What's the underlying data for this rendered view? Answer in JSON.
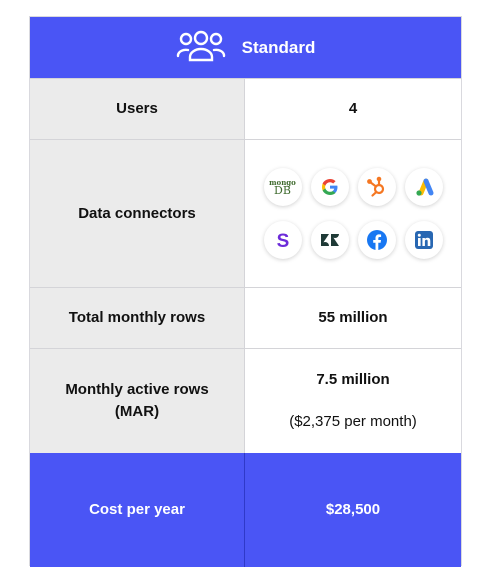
{
  "plan": {
    "title": "Standard",
    "icon": "users-group-icon",
    "accent": "#4a55f5"
  },
  "rows": [
    {
      "label": "Users",
      "value": "4"
    },
    {
      "label": "Data connectors"
    },
    {
      "label": "Total monthly rows",
      "value": "55 million"
    },
    {
      "label": "Monthly active rows (MAR)",
      "value": "7.5 million",
      "sub": "($2,375 per month)"
    },
    {
      "label": "Cost per year",
      "value": "$28,500"
    }
  ],
  "connectors": [
    {
      "icon": "mongodb-icon",
      "text_top": "mongo",
      "text_bottom": "DB"
    },
    {
      "icon": "google-icon"
    },
    {
      "icon": "hubspot-icon"
    },
    {
      "icon": "google-ads-icon"
    },
    {
      "icon": "stripe-icon"
    },
    {
      "icon": "zendesk-icon"
    },
    {
      "icon": "facebook-icon"
    },
    {
      "icon": "linkedin-icon"
    }
  ]
}
